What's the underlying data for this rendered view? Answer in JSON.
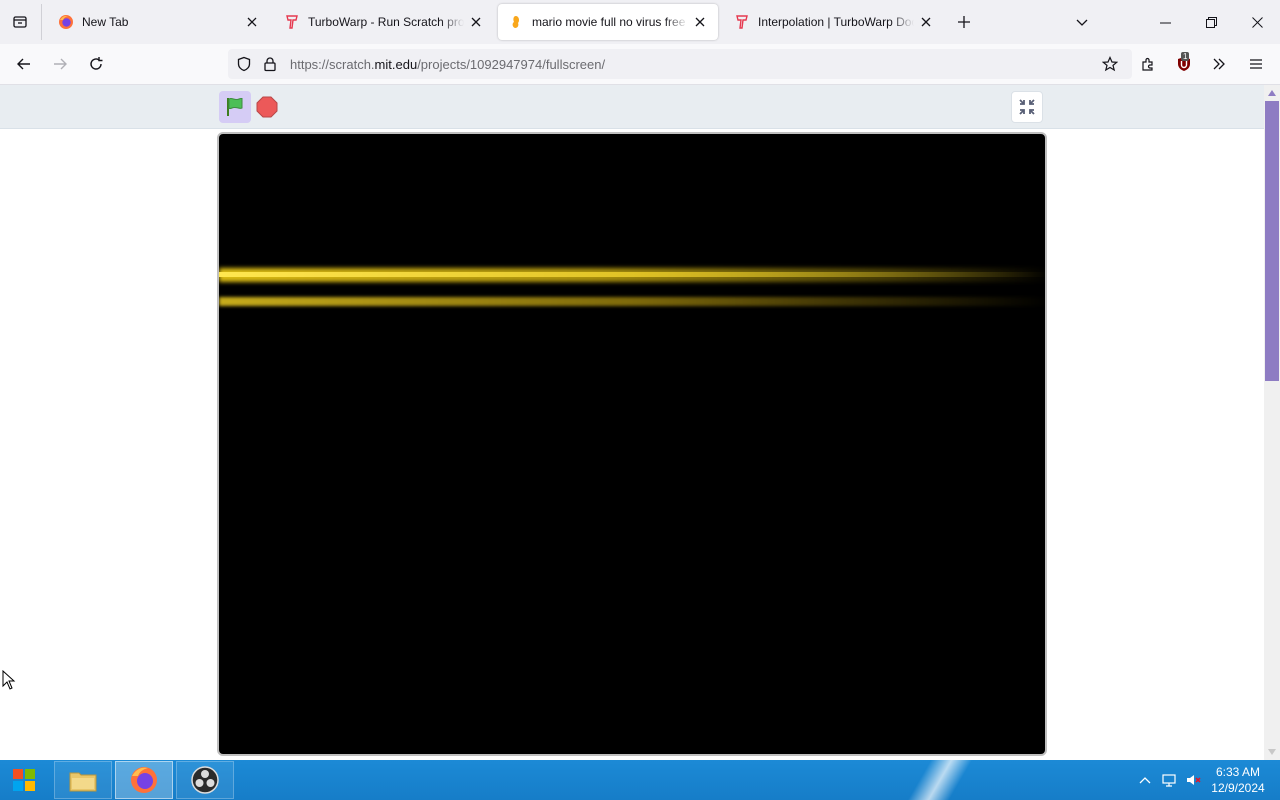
{
  "tabs": [
    {
      "title": "New Tab",
      "favicon": "firefox-icon",
      "active": false
    },
    {
      "title": "TurboWarp - Run Scratch projects faster",
      "favicon": "turbowarp-icon",
      "active": false
    },
    {
      "title": "mario movie full no virus free download",
      "favicon": "scratch-icon",
      "active": true
    },
    {
      "title": "Interpolation | TurboWarp Documentation",
      "favicon": "turbowarp-icon",
      "active": false
    }
  ],
  "navbar": {
    "url_prefix": "https://scratch.",
    "url_domain": "mit.edu",
    "url_path": "/projects/1092947974/fullscreen/",
    "ublock_badge": "1"
  },
  "taskbar": {
    "clock_time": "6:33 AM",
    "clock_date": "12/9/2024"
  },
  "colors": {
    "stage_bg": "#000000",
    "beam": "#e6c414",
    "header_bg": "#e8edf1",
    "flag_active_bg": "#d5ccf5",
    "taskbar": "#1c8ad6"
  }
}
